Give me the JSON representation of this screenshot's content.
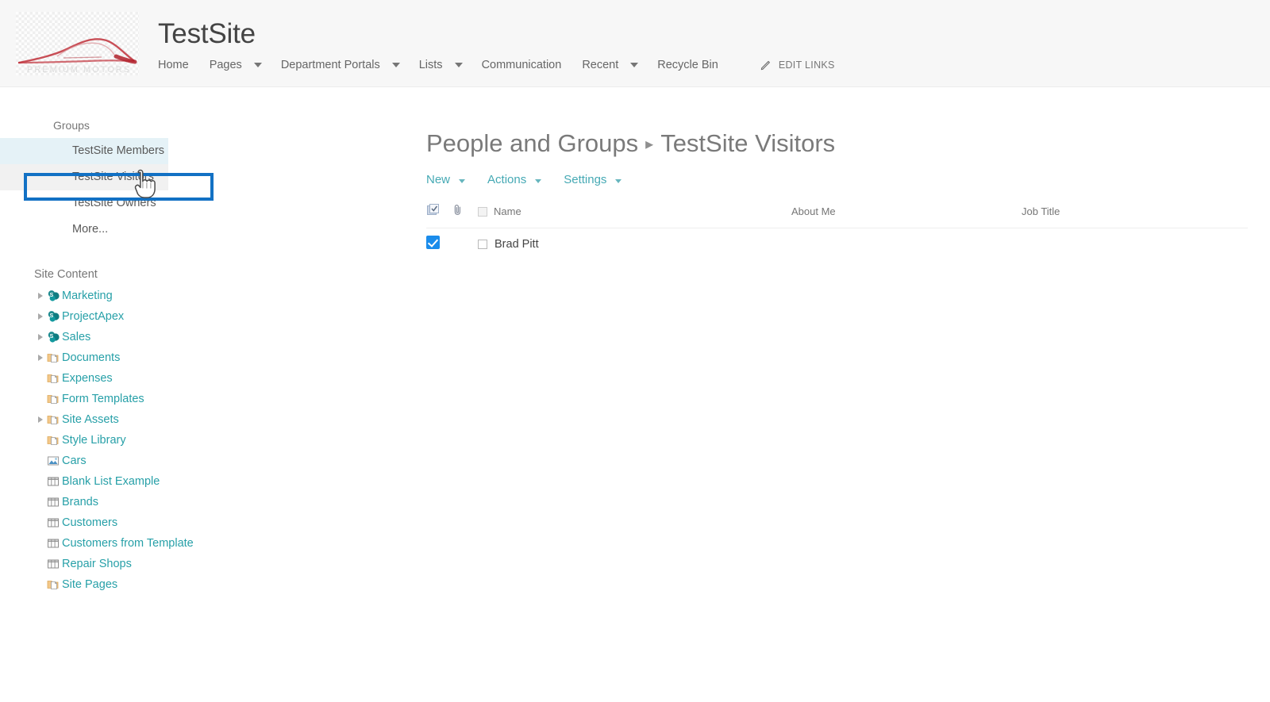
{
  "header": {
    "site_title": "TestSite",
    "logo_icon": "car-silhouette-logo",
    "nav": [
      {
        "label": "Home",
        "has_dropdown": false
      },
      {
        "label": "Pages",
        "has_dropdown": true
      },
      {
        "label": "Department Portals",
        "has_dropdown": true
      },
      {
        "label": "Lists",
        "has_dropdown": true
      },
      {
        "label": "Communication",
        "has_dropdown": false
      },
      {
        "label": "Recent",
        "has_dropdown": true
      },
      {
        "label": "Recycle Bin",
        "has_dropdown": false
      }
    ],
    "edit_links_label": "EDIT LINKS",
    "edit_links_icon": "pencil-icon"
  },
  "left_nav": {
    "groups_heading": "Groups",
    "groups": [
      {
        "label": "TestSite Members",
        "state": "highlighted"
      },
      {
        "label": "TestSite Visitors",
        "state": "current"
      },
      {
        "label": "TestSite Owners",
        "state": "normal"
      },
      {
        "label": "More...",
        "state": "normal"
      }
    ],
    "selection_highlight_color": "#1271c4",
    "site_content_heading": "Site Content",
    "site_content": [
      {
        "label": "Marketing",
        "icon": "sharepoint-site-icon",
        "expandable": true
      },
      {
        "label": "ProjectApex",
        "icon": "sharepoint-site-icon",
        "expandable": true
      },
      {
        "label": "Sales",
        "icon": "sharepoint-site-icon",
        "expandable": true
      },
      {
        "label": "Documents",
        "icon": "document-library-icon",
        "expandable": true
      },
      {
        "label": "Expenses",
        "icon": "document-library-icon",
        "expandable": false
      },
      {
        "label": "Form Templates",
        "icon": "document-library-icon",
        "expandable": false
      },
      {
        "label": "Site Assets",
        "icon": "document-library-icon",
        "expandable": true
      },
      {
        "label": "Style Library",
        "icon": "document-library-icon",
        "expandable": false
      },
      {
        "label": "Cars",
        "icon": "picture-library-icon",
        "expandable": false
      },
      {
        "label": "Blank List Example",
        "icon": "list-icon",
        "expandable": false
      },
      {
        "label": "Brands",
        "icon": "list-icon",
        "expandable": false
      },
      {
        "label": "Customers",
        "icon": "list-icon",
        "expandable": false
      },
      {
        "label": "Customers from Template",
        "icon": "list-icon",
        "expandable": false
      },
      {
        "label": "Repair Shops",
        "icon": "list-icon",
        "expandable": false
      },
      {
        "label": "Site Pages",
        "icon": "document-library-icon",
        "expandable": false
      }
    ]
  },
  "main": {
    "title_primary": "People and Groups",
    "title_separator": "▸",
    "title_secondary": "TestSite Visitors",
    "toolbar": [
      {
        "label": "New",
        "has_dropdown": true
      },
      {
        "label": "Actions",
        "has_dropdown": true
      },
      {
        "label": "Settings",
        "has_dropdown": true
      }
    ],
    "table": {
      "select_all_icon": "select-all-checkbox-icon",
      "attachment_icon": "paperclip-icon",
      "columns": [
        "Name",
        "About Me",
        "Job Title"
      ],
      "rows": [
        {
          "selected": true,
          "name": "Brad Pitt",
          "about_me": "",
          "job_title": ""
        }
      ]
    }
  },
  "cursor": {
    "icon": "hand-pointer-cursor"
  }
}
